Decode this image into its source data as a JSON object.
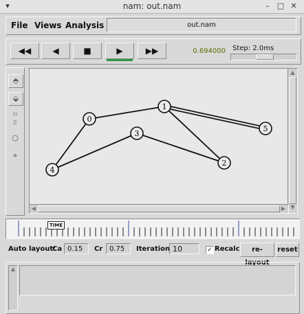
{
  "window": {
    "title": "nam: out.nam"
  },
  "menu": {
    "file": "File",
    "views": "Views",
    "analysis": "Analysis",
    "filename": "out.nam"
  },
  "controls": {
    "rewind": "◀◀",
    "back": "◀",
    "stop": "■",
    "play": "▶",
    "forward": "▶▶",
    "time": "0.694000",
    "step_label": "Step: 2.0ms",
    "active": "play",
    "accent_color": "#2f9a44"
  },
  "toolbar": {
    "icons": [
      "zoom-in-icon",
      "zoom-out-icon",
      "edit-icon",
      "circle-icon",
      "crosshair-icon"
    ]
  },
  "network": {
    "nodes": [
      {
        "id": "0",
        "label": "0"
      },
      {
        "id": "1",
        "label": "1"
      },
      {
        "id": "2",
        "label": "2"
      },
      {
        "id": "3",
        "label": "3"
      },
      {
        "id": "4",
        "label": "4"
      },
      {
        "id": "5",
        "label": "5"
      }
    ],
    "links": [
      [
        "0",
        "1"
      ],
      [
        "0",
        "4"
      ],
      [
        "4",
        "3"
      ],
      [
        "3",
        "2"
      ],
      [
        "1",
        "2"
      ],
      [
        "1",
        "5"
      ]
    ],
    "duplex_links": [
      [
        "1",
        "5"
      ]
    ]
  },
  "timeline": {
    "marker": "TIME"
  },
  "autolayout": {
    "label": "Auto layout:",
    "ca_label": "Ca",
    "ca_value": "0.15",
    "cr_label": "Cr",
    "cr_value": "0.75",
    "iterations_label": "Iterations",
    "iterations_value": "10",
    "recalc_label": "Recalc",
    "recalc_checked": true,
    "relayout_label": "re-layout",
    "reset_label": "reset"
  }
}
